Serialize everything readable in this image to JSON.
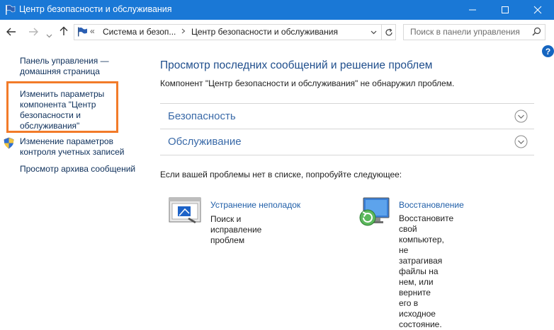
{
  "window": {
    "title": "Центр безопасности и обслуживания",
    "icon": "control-panel-flag-icon",
    "accent": "#1a78d6"
  },
  "nav": {
    "back_icon": "back-arrow-icon",
    "forward_icon": "forward-arrow-icon",
    "recent_icon": "chevron-down-icon",
    "up_icon": "up-arrow-icon"
  },
  "address": {
    "overflow": "«",
    "crumbs": [
      "Система и безоп...",
      "Центр безопасности и обслуживания"
    ]
  },
  "search": {
    "placeholder": "Поиск в панели управления"
  },
  "help": {
    "label": "?"
  },
  "sidebar": {
    "items": [
      {
        "label_lines": [
          "Панель управления —",
          "домашняя страница"
        ]
      },
      {
        "label_lines": [
          "Изменить параметры",
          "компонента \"Центр",
          "безопасности и",
          "обслуживания\""
        ],
        "highlighted": true,
        "highlight_color": "#f27b29"
      },
      {
        "label_lines": [
          "Изменение параметров",
          "контроля учетных записей"
        ],
        "icon": "uac-shield-icon"
      },
      {
        "label_lines": [
          "Просмотр архива сообщений"
        ]
      }
    ]
  },
  "main": {
    "heading": "Просмотр последних сообщений и решение проблем",
    "status": "Компонент \"Центр безопасности и обслуживания\" не обнаружил проблем.",
    "sections": [
      {
        "label": "Безопасность"
      },
      {
        "label": "Обслуживание"
      }
    ],
    "suggestion": "Если вашей проблемы нет в списке, попробуйте следующее:",
    "tools": [
      {
        "title": "Устранение неполадок",
        "desc_lines": [
          "Поиск и исправление проблем"
        ],
        "icon": "troubleshooting-icon"
      },
      {
        "title": "Восстановление",
        "desc_lines": [
          "Восстановите свой",
          "компьютер, не затрагивая",
          "файлы на нем, или верните",
          "его в исходное состояние."
        ],
        "icon": "recovery-icon"
      }
    ]
  }
}
